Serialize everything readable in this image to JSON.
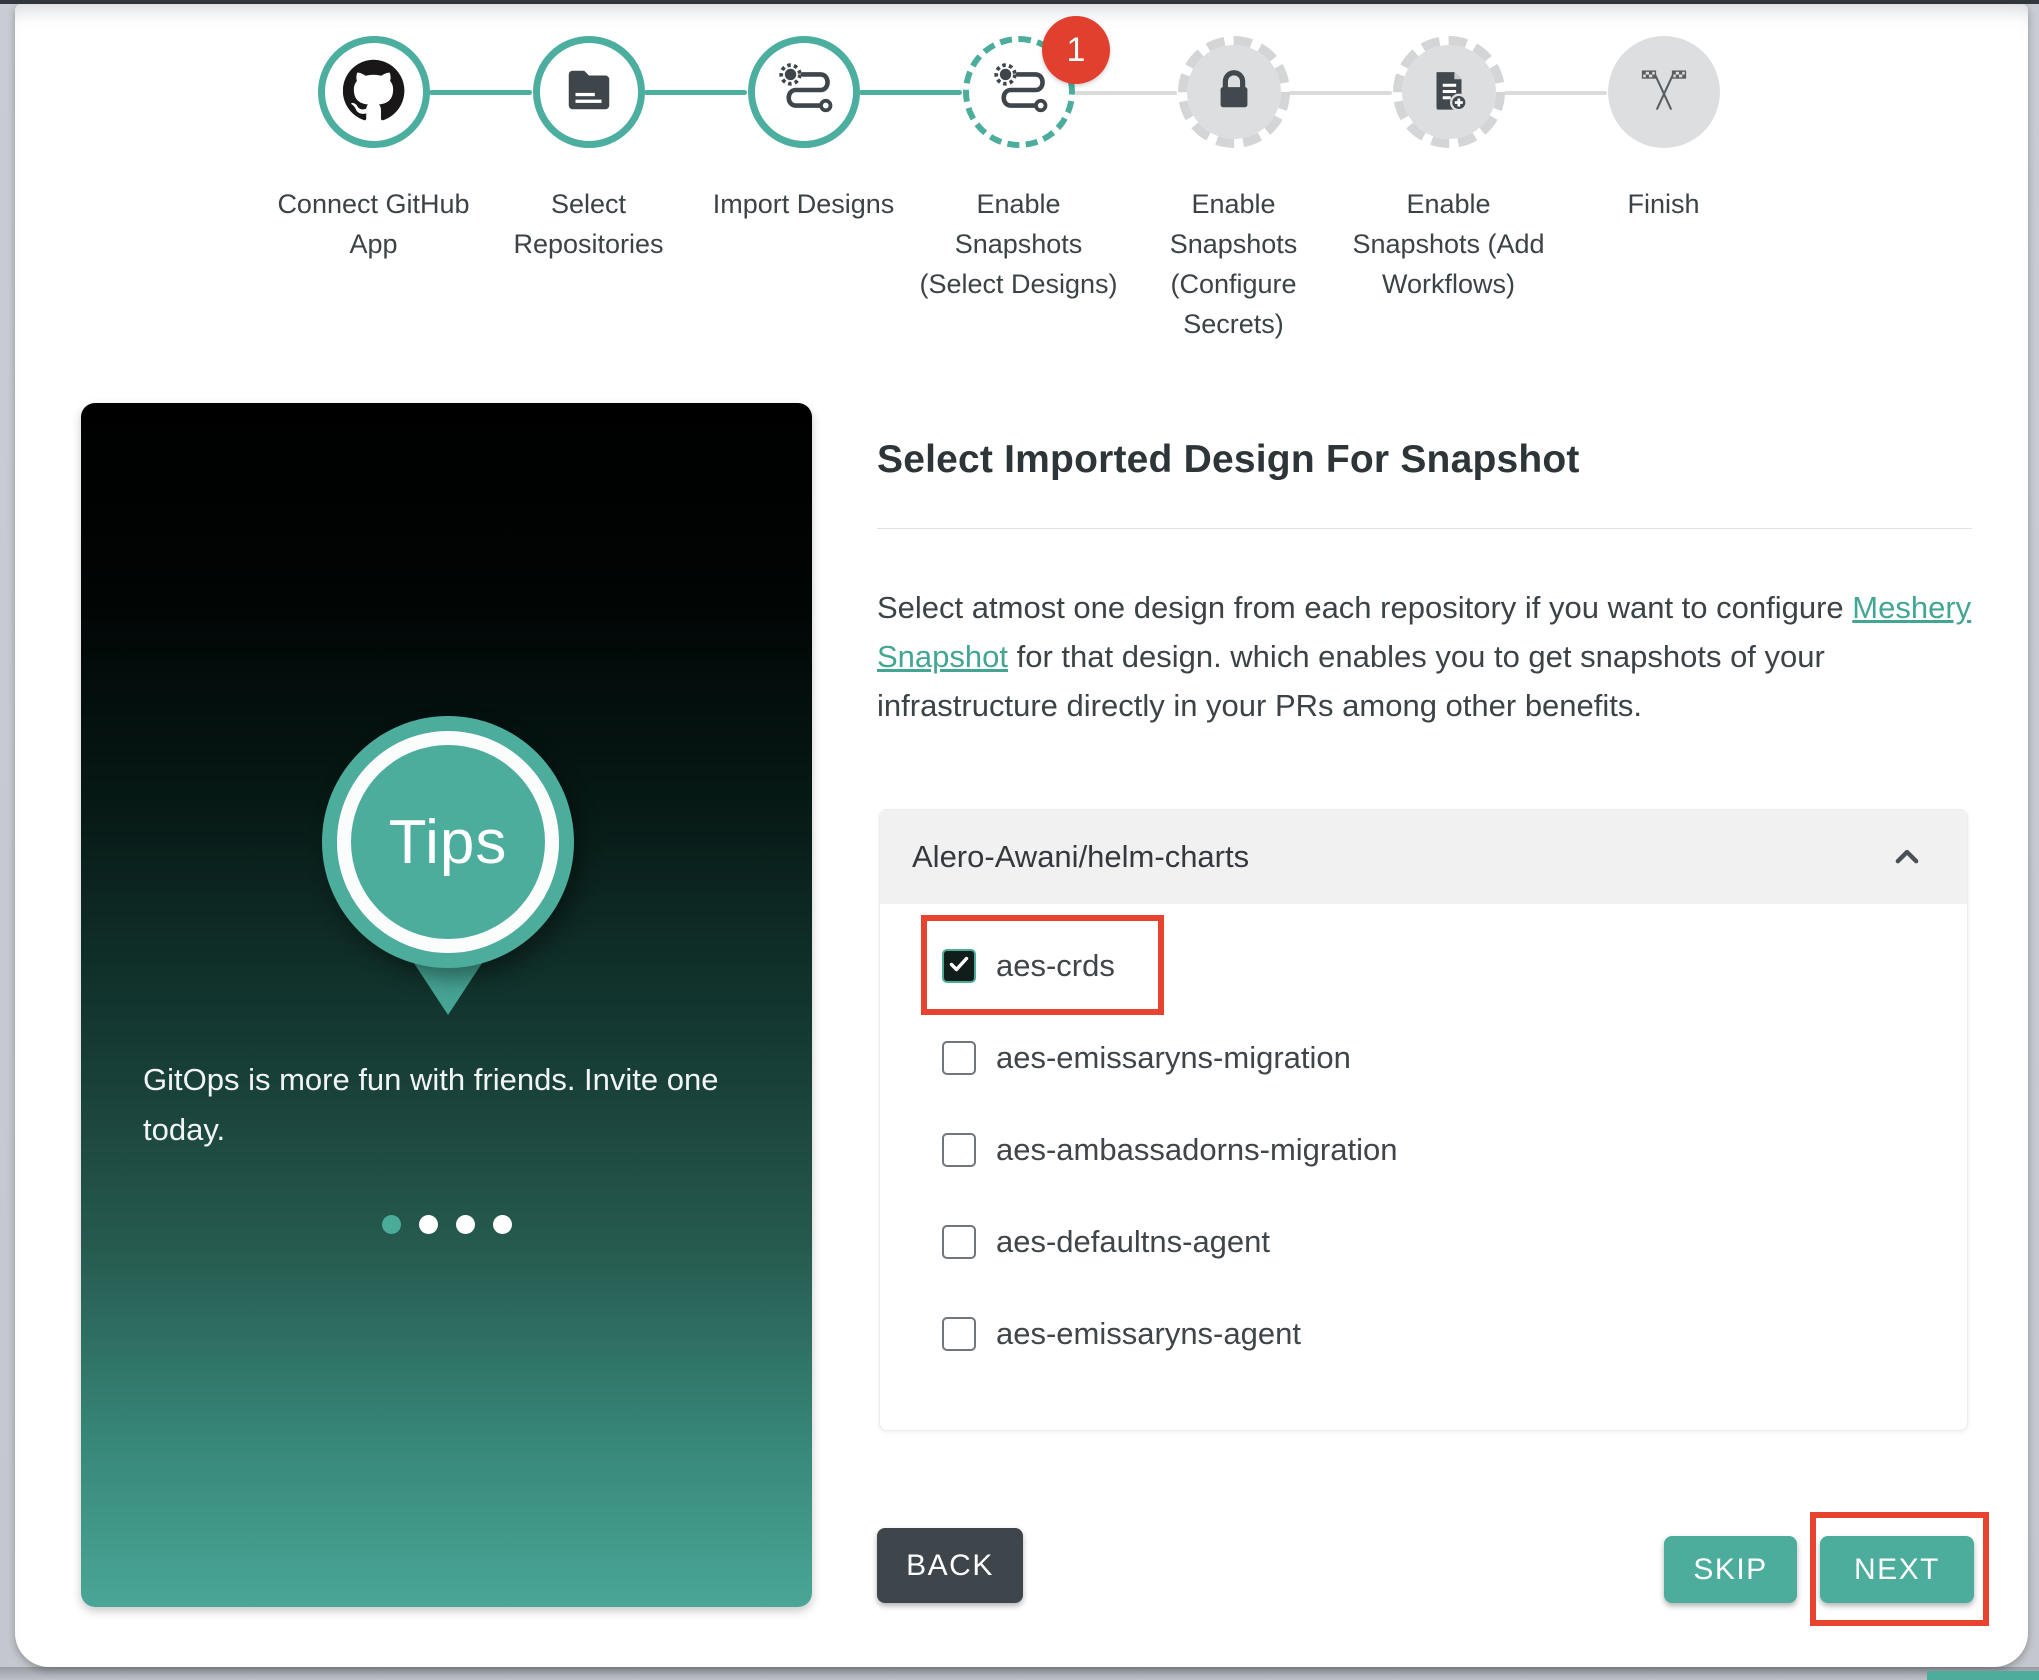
{
  "window": {
    "background": "#C5C9CF",
    "card_background": "#FFFFFF"
  },
  "colors": {
    "teal": "#4CAD9D",
    "stepper_ring_teal": "#4CAE9F",
    "link_teal": "#43A695",
    "badge_red": "#E2402F",
    "annotation_red": "#E8432E",
    "dark_slate": "#3E464B",
    "pending_gray": "#DCDEE0"
  },
  "stepper": {
    "steps": [
      {
        "label": "Connect GitHub App",
        "icon": "github-icon",
        "state": "completed"
      },
      {
        "label": "Select Repositories",
        "icon": "repository-icon",
        "state": "completed"
      },
      {
        "label": "Import Designs",
        "icon": "route-icon",
        "state": "completed"
      },
      {
        "label": "Enable Snapshots (Select Designs)",
        "icon": "route-icon",
        "state": "active",
        "badge": "1"
      },
      {
        "label": "Enable Snapshots (Configure Secrets)",
        "icon": "lock-icon",
        "state": "pending"
      },
      {
        "label": "Enable Snapshots (Add Workflows)",
        "icon": "doc-plus-icon",
        "state": "pending"
      },
      {
        "label": "Finish",
        "icon": "checkered-flags-icon",
        "state": "pending"
      }
    ]
  },
  "tips": {
    "title": "Tips",
    "message": "GitOps is more fun with friends. Invite one today.",
    "dot_count": 4,
    "active_dot": 1
  },
  "content": {
    "heading": "Select Imported Design For Snapshot",
    "description_prefix": "Select atmost one design from each repository if you want to configure ",
    "link_text": "Meshery Snapshot",
    "description_suffix": " for that design. which enables you to get snapshots of your infrastructure directly in your PRs among other benefits.",
    "accordion": {
      "title": "Alero-Awani/helm-charts",
      "expanded": true,
      "items": [
        {
          "label": "aes-crds",
          "checked": true,
          "highlighted": true
        },
        {
          "label": "aes-emissaryns-migration",
          "checked": false
        },
        {
          "label": "aes-ambassadorns-migration",
          "checked": false
        },
        {
          "label": "aes-defaultns-agent",
          "checked": false
        },
        {
          "label": "aes-emissaryns-agent",
          "checked": false
        }
      ]
    },
    "buttons": {
      "back": "BACK",
      "skip": "SKIP",
      "next": "NEXT"
    }
  },
  "annotations": {
    "color": "#E8432E",
    "targets": [
      "aes-crds checkbox row",
      "NEXT button"
    ]
  }
}
